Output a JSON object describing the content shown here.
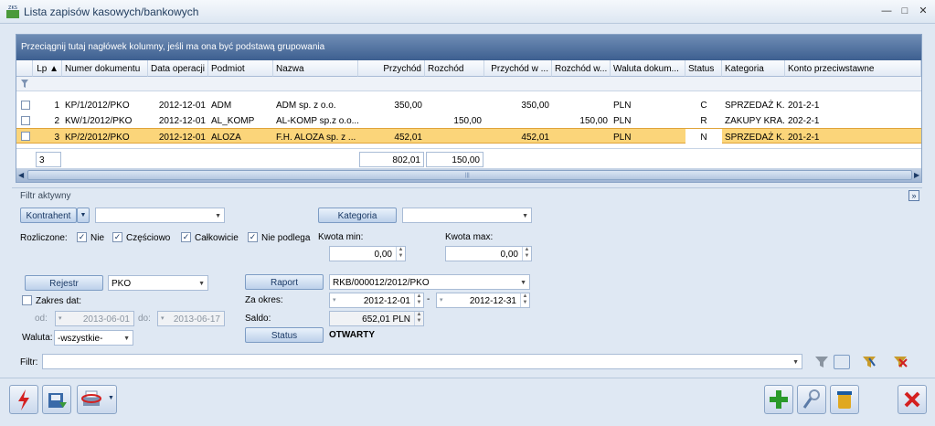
{
  "window": {
    "title": "Lista zapisów kasowych/bankowych",
    "logo_text": "ZKS",
    "minimize": "—",
    "maximize": "□",
    "close": "✕"
  },
  "grid": {
    "group_hint": "Przeciągnij tutaj nagłówek kolumny, jeśli ma ona być podstawą grupowania",
    "columns": [
      "Lp ▲",
      "Numer dokumentu",
      "Data operacji",
      "Podmiot",
      "Nazwa",
      "Przychód",
      "Rozchód",
      "Przychód w ...",
      "Rozchód w...",
      "Waluta dokum...",
      "Status",
      "Kategoria",
      "Konto przeciwstawne"
    ],
    "rows": [
      {
        "lp": "1",
        "numer": "KP/1/2012/PKO",
        "data": "2012-12-01",
        "podmiot": "ADM",
        "nazwa": "ADM sp. z o.o.",
        "przychod": "350,00",
        "rozchod": "",
        "przychod_w": "350,00",
        "rozchod_w": "",
        "waluta": "PLN",
        "status": "C",
        "kategoria": "SPRZEDAŻ K...",
        "konto": "201-2-1"
      },
      {
        "lp": "2",
        "numer": "KW/1/2012/PKO",
        "data": "2012-12-01",
        "podmiot": "AL_KOMP",
        "nazwa": "AL-KOMP sp.z o.o....",
        "przychod": "",
        "rozchod": "150,00",
        "przychod_w": "",
        "rozchod_w": "150,00",
        "waluta": "PLN",
        "status": "R",
        "kategoria": "ZAKUPY KRA...",
        "konto": "202-2-1"
      },
      {
        "lp": "3",
        "numer": "KP/2/2012/PKO",
        "data": "2012-12-01",
        "podmiot": "ALOZA",
        "nazwa": "F.H. ALOZA sp. z ...",
        "przychod": "452,01",
        "rozchod": "",
        "przychod_w": "452,01",
        "rozchod_w": "",
        "waluta": "PLN",
        "status": "N",
        "kategoria": "SPRZEDAŻ K...",
        "konto": "201-2-1"
      }
    ],
    "summary": {
      "count": "3",
      "przychod": "802,01",
      "rozchod": "150,00"
    }
  },
  "filter": {
    "panel_label": "Filtr aktywny",
    "kontrahent_btn": "Kontrahent",
    "kontrahent_value": "",
    "kategoria_btn": "Kategoria",
    "kategoria_value": "",
    "rozliczone_label": "Rozliczone:",
    "rozliczone_options": [
      {
        "label": "Nie",
        "checked": true
      },
      {
        "label": "Częściowo",
        "checked": true
      },
      {
        "label": "Całkowicie",
        "checked": true
      },
      {
        "label": "Nie podlega",
        "checked": true
      }
    ],
    "kwota_min_label": "Kwota min:",
    "kwota_min": "0,00",
    "kwota_max_label": "Kwota max:",
    "kwota_max": "0,00",
    "rejestr_btn": "Rejestr",
    "rejestr_value": "PKO",
    "raport_btn": "Raport",
    "raport_value": "RKB/000012/2012/PKO",
    "zakres_dat_label": "Zakres dat:",
    "od_label": "od:",
    "od_value": "2013-06-01",
    "do_label": "do:",
    "do_value": "2013-06-17",
    "za_okres_label": "Za okres:",
    "okres_od": "2012-12-01",
    "okres_sep": "-",
    "okres_do": "2012-12-31",
    "saldo_label": "Saldo:",
    "saldo_value": "652,01 PLN",
    "waluta_label": "Waluta:",
    "waluta_value": "-wszystkie-",
    "status_btn": "Status",
    "status_value": "OTWARTY",
    "filtr_label": "Filtr:",
    "filtr_value": ""
  }
}
